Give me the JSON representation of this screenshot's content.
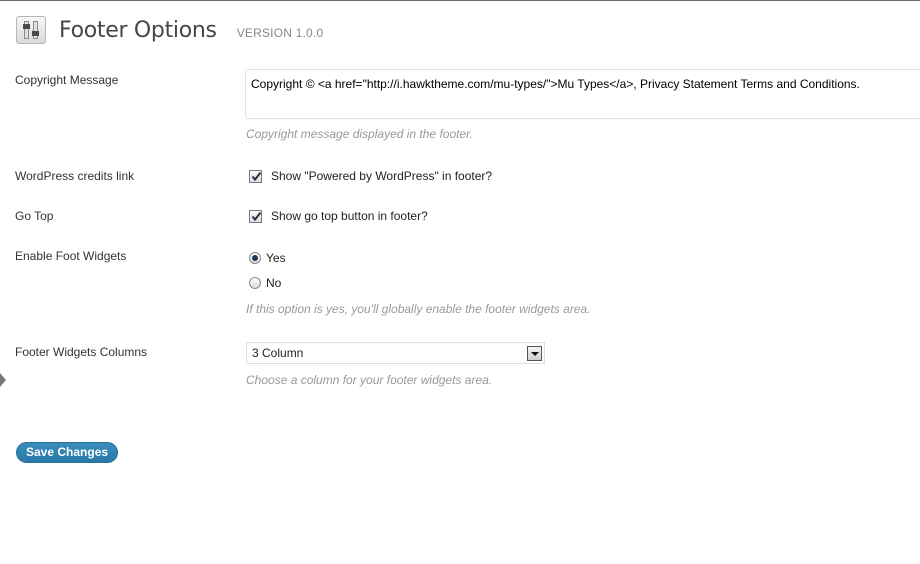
{
  "header": {
    "title": "Footer Options",
    "version": "VERSION 1.0.0",
    "icon": "settings-sliders-icon"
  },
  "copyright": {
    "label": "Copyright Message",
    "value": "Copyright © <a href=\"http://i.hawktheme.com/mu-types/\">Mu Types</a>, Privacy Statement Terms and Conditions.",
    "description": "Copyright message displayed in the footer."
  },
  "credits": {
    "label": "WordPress credits link",
    "checkbox_text": "Show \"Powered by WordPress\" in footer?",
    "checked": true
  },
  "gotop": {
    "label": "Go Top",
    "checkbox_text": "Show go top button in footer?",
    "checked": true
  },
  "widgets": {
    "label": "Enable Foot Widgets",
    "options": [
      "Yes",
      "No"
    ],
    "selected": "Yes",
    "description": "If this option is yes, you'll globally enable the footer widgets area."
  },
  "columns": {
    "label": "Footer Widgets Columns",
    "selected": "3 Column",
    "description": "Choose a column for your footer widgets area."
  },
  "actions": {
    "save_label": "Save Changes"
  },
  "colors": {
    "accent": "#2778a8",
    "description_text": "#999999"
  }
}
